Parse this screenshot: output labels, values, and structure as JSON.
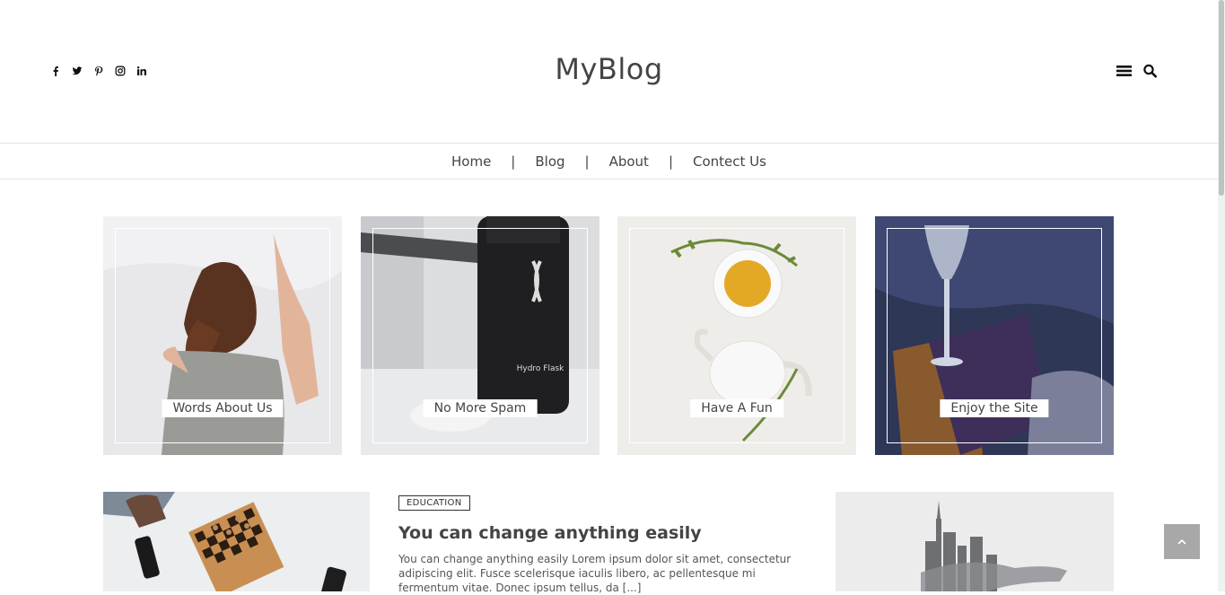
{
  "site": {
    "logo": "MyBlog"
  },
  "social": [
    "facebook-icon",
    "twitter-icon",
    "pinterest-icon",
    "instagram-icon",
    "linkedin-icon"
  ],
  "nav": {
    "items": [
      "Home",
      "Blog",
      "About",
      "Contect Us"
    ],
    "separator": "|"
  },
  "cards": [
    {
      "label": "Words About Us"
    },
    {
      "label": "No More Spam"
    },
    {
      "label": "Have A Fun"
    },
    {
      "label": "Enjoy the Site"
    }
  ],
  "post": {
    "category": "EDUCATION",
    "title": "You can change anything easily",
    "excerpt": "You can change anything easily Lorem ipsum dolor sit amet, consectetur adipiscing elit. Fusce scelerisque iaculis libero, ac pellentesque mi fermentum vitae. Donec ipsum tellus, da [...]"
  },
  "colors": {
    "text": "#444444",
    "divider": "#e3e3e3",
    "to_top_bg": "#a8a8a8"
  }
}
